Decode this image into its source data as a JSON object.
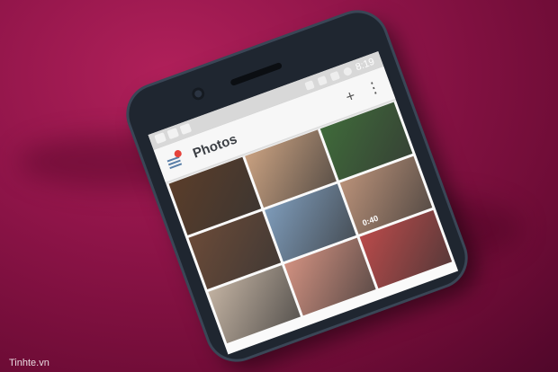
{
  "status_bar": {
    "time": "8:19",
    "icons": [
      "location-icon",
      "wifi-icon",
      "signal-icon",
      "battery-icon"
    ],
    "notification_icons": [
      "gallery-icon",
      "camera-icon",
      "camera-icon"
    ]
  },
  "app_bar": {
    "title": "Photos",
    "add_icon": "+",
    "overflow_icon": "⋮"
  },
  "accent": "#e5433b",
  "photos": [
    {
      "color": "#5a3d2a"
    },
    {
      "color": "#c8a080"
    },
    {
      "color": "#3f6a3a"
    },
    {
      "color": "#6a4a38"
    },
    {
      "color": "#7d9ab8"
    },
    {
      "color": "#b89078",
      "duration": "0:40"
    },
    {
      "color": "#c0b0a0"
    },
    {
      "color": "#d09080"
    },
    {
      "color": "#b84a4a"
    }
  ],
  "watermark": "Tinhte.vn"
}
